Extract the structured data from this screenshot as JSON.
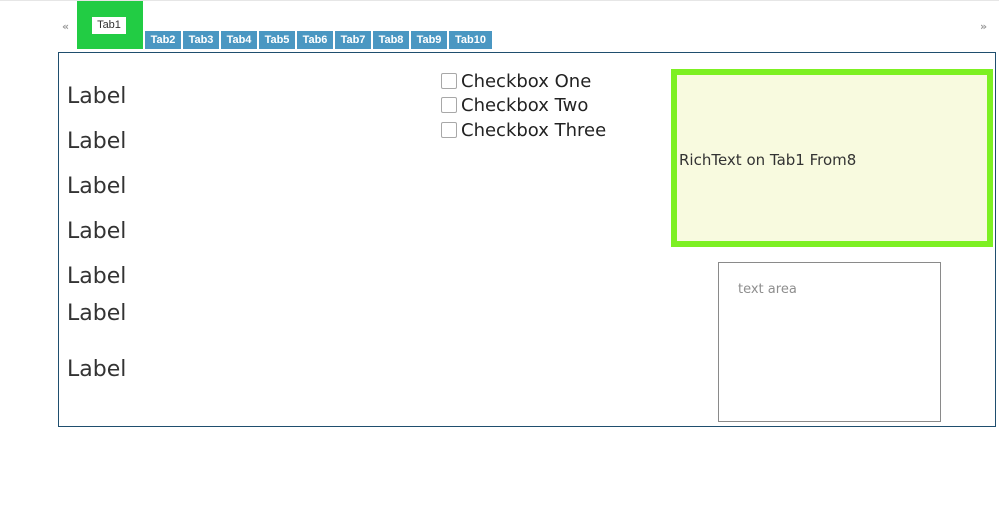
{
  "tabs": {
    "scroll_left": "«",
    "scroll_right": "»",
    "active": "Tab1",
    "items": [
      "Tab2",
      "Tab3",
      "Tab4",
      "Tab5",
      "Tab6",
      "Tab7",
      "Tab8",
      "Tab9",
      "Tab10"
    ]
  },
  "labels": [
    "Label",
    "Label",
    "Label",
    "Label",
    "Label",
    "Label",
    "Label"
  ],
  "checkboxes": [
    {
      "label": "Checkbox One",
      "checked": false
    },
    {
      "label": "Checkbox Two",
      "checked": false
    },
    {
      "label": "Checkbox Three",
      "checked": false
    }
  ],
  "richtext": {
    "text": "RichText on Tab1 From8"
  },
  "textarea": {
    "placeholder": "text area",
    "value": ""
  },
  "colors": {
    "active_tab": "#22cc44",
    "tab": "#4a97c2",
    "richtext_border": "#7df022",
    "richtext_bg": "#f8fadf",
    "panel_border": "#1f4e6e"
  }
}
